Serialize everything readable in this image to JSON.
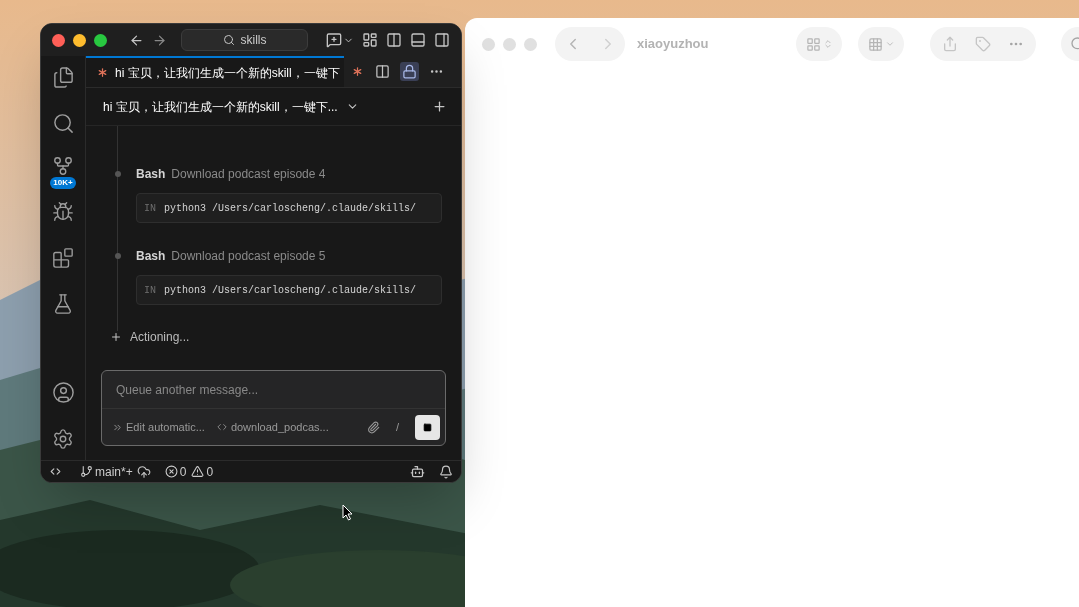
{
  "editor": {
    "search": "skills",
    "activity_badge": "10K+",
    "tab": {
      "title": "hi 宝贝，让我们生成一个新的skill，一键下"
    },
    "chat_header": {
      "title": "hi 宝贝，让我们生成一个新的skill，一键下..."
    },
    "timeline": [
      {
        "kind": "step",
        "tool": "Bash",
        "description": "Download podcast episode 4"
      },
      {
        "kind": "command",
        "input_label": "IN",
        "command": "python3 /Users/carloscheng/.claude/skills/"
      },
      {
        "kind": "step",
        "tool": "Bash",
        "description": "Download podcast episode 5"
      },
      {
        "kind": "command",
        "input_label": "IN",
        "command": "python3 /Users/carloscheng/.claude/skills/"
      }
    ],
    "status_line": "Actioning...",
    "composer": {
      "placeholder": "Queue another message...",
      "mode": "Edit automatic...",
      "file": "download_podcas...",
      "slash": "/"
    },
    "status_bar": {
      "branch": "main*+",
      "errors": "0",
      "warnings": "0"
    }
  },
  "finder": {
    "title": "xiaoyuzhou"
  }
}
